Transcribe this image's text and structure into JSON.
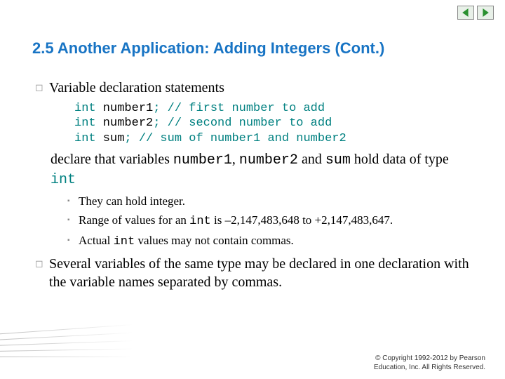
{
  "heading": "2.5  Another Application: Adding Integers (Cont.)",
  "bullet1": "Variable declaration statements",
  "code": {
    "l1_kw": "int",
    "l1_var": " number1",
    "l1_rest": "; // first number to add",
    "l2_kw": "int",
    "l2_var": " number2",
    "l2_rest": "; // second number to add",
    "l3_kw": "int",
    "l3_var": " sum",
    "l3_rest": "; // sum of number1 and number2"
  },
  "cont_pre": "declare that variables ",
  "cont_n1": "number1",
  "cont_c1": ", ",
  "cont_n2": "number2",
  "cont_c2": " and ",
  "cont_sum": "sum",
  "cont_mid": " hold data of type ",
  "cont_int": "int",
  "sub1": "They can hold integer.",
  "sub2_pre": "Range of values for an ",
  "sub2_int": "int",
  "sub2_post": " is –2,147,483,648 to +2,147,483,647.",
  "sub3_pre": "Actual ",
  "sub3_int": "int",
  "sub3_post": " values may not contain commas.",
  "bullet2": "Several variables of the same type may be declared in one declaration with the variable names separated by commas.",
  "copyright_l1": "© Copyright 1992-2012 by Pearson",
  "copyright_l2": "Education, Inc. All Rights Reserved."
}
